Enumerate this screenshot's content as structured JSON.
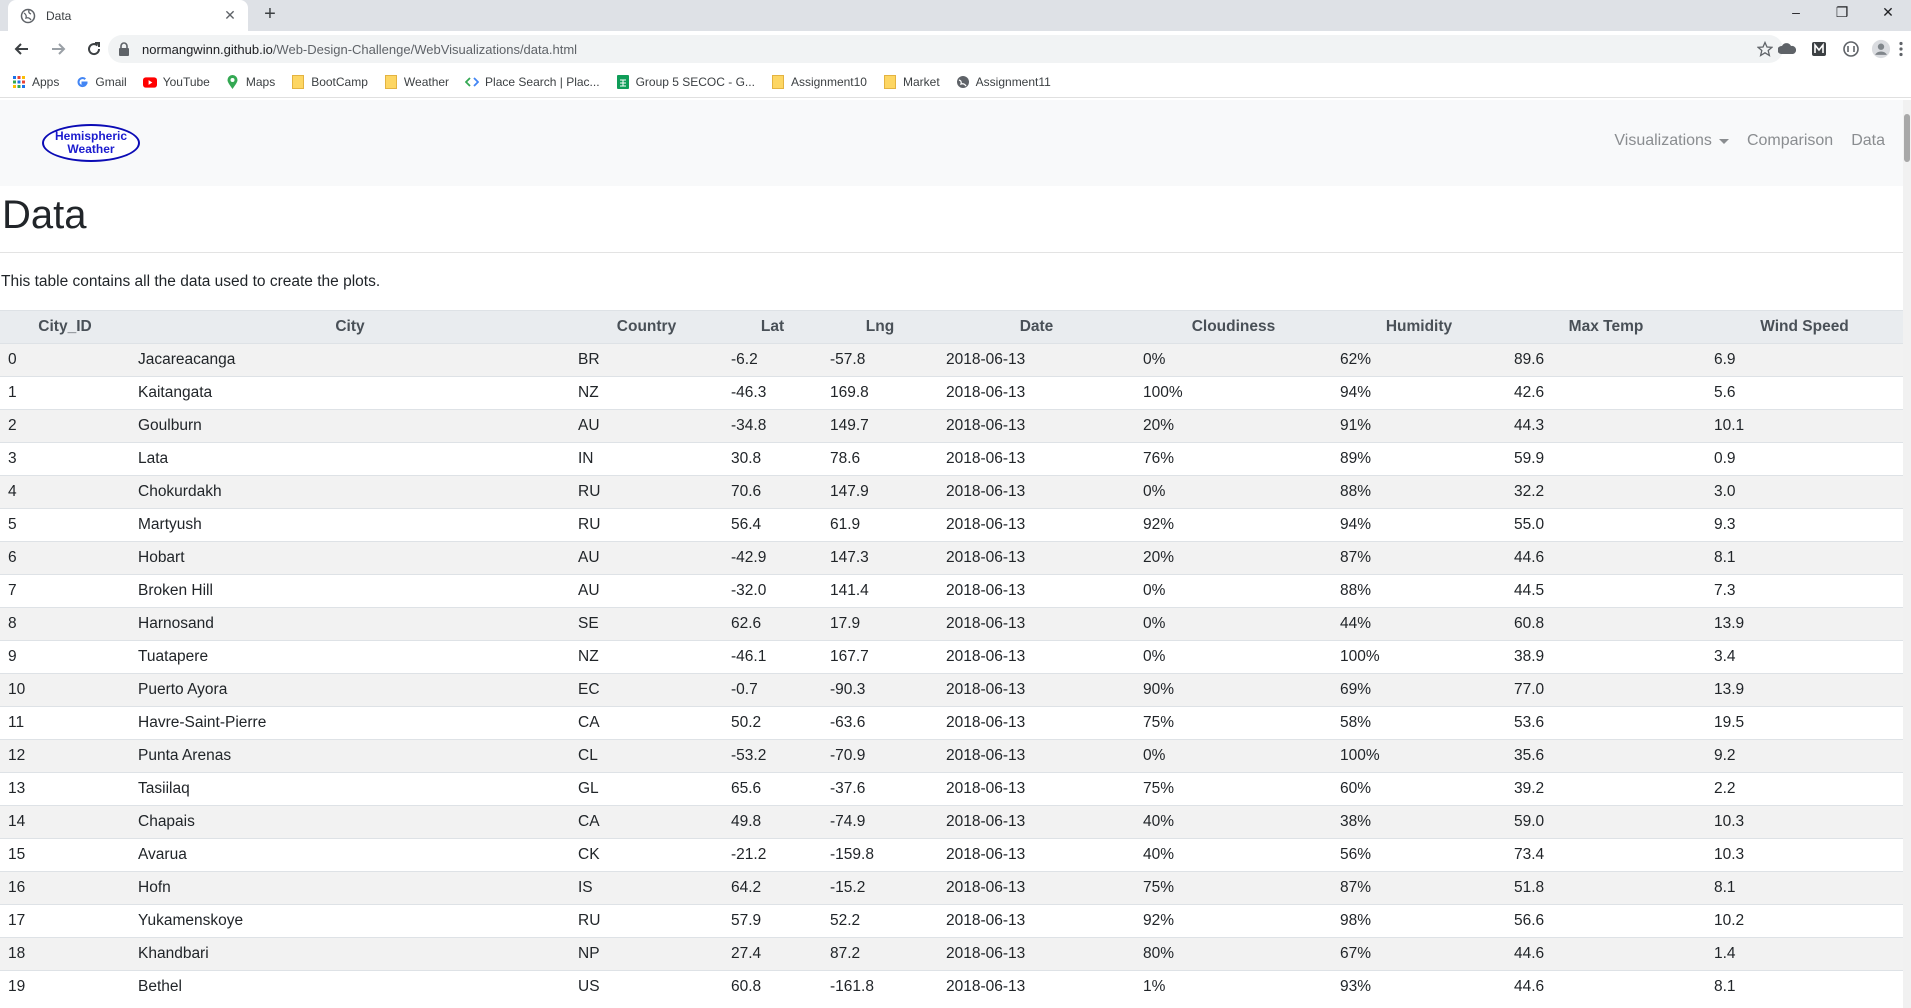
{
  "browser": {
    "tab_title": "Data",
    "url_host": "normangwinn.github.io",
    "url_path": "/Web-Design-Challenge/WebVisualizations/data.html",
    "new_tab_symbol": "+",
    "close_symbol": "✕",
    "window_controls": {
      "minimize": "–",
      "restore": "❐",
      "close": "✕"
    },
    "bookmarks": [
      {
        "label": "Apps",
        "icon": "apps-grid-icon"
      },
      {
        "label": "Gmail",
        "icon": "google-icon"
      },
      {
        "label": "YouTube",
        "icon": "youtube-icon"
      },
      {
        "label": "Maps",
        "icon": "maps-pin-icon"
      },
      {
        "label": "BootCamp",
        "icon": "folder-icon"
      },
      {
        "label": "Weather",
        "icon": "folder-icon"
      },
      {
        "label": "Place Search | Plac...",
        "icon": "code-icon"
      },
      {
        "label": "Group 5 SECOC - G...",
        "icon": "sheets-icon"
      },
      {
        "label": "Assignment10",
        "icon": "folder-icon"
      },
      {
        "label": "Market",
        "icon": "folder-icon"
      },
      {
        "label": "Assignment11",
        "icon": "globe-icon"
      }
    ]
  },
  "site": {
    "logo_line1": "Hemispheric",
    "logo_line2": "Weather",
    "nav": {
      "visualizations": "Visualizations",
      "comparison": "Comparison",
      "data": "Data"
    },
    "title": "Data",
    "description": "This table contains all the data used to create the plots."
  },
  "table": {
    "headers": [
      "City_ID",
      "City",
      "Country",
      "Lat",
      "Lng",
      "Date",
      "Cloudiness",
      "Humidity",
      "Max Temp",
      "Wind Speed"
    ],
    "rows": [
      [
        "0",
        "Jacareacanga",
        "BR",
        "-6.2",
        "-57.8",
        "2018-06-13",
        "0%",
        "62%",
        "89.6",
        "6.9"
      ],
      [
        "1",
        "Kaitangata",
        "NZ",
        "-46.3",
        "169.8",
        "2018-06-13",
        "100%",
        "94%",
        "42.6",
        "5.6"
      ],
      [
        "2",
        "Goulburn",
        "AU",
        "-34.8",
        "149.7",
        "2018-06-13",
        "20%",
        "91%",
        "44.3",
        "10.1"
      ],
      [
        "3",
        "Lata",
        "IN",
        "30.8",
        "78.6",
        "2018-06-13",
        "76%",
        "89%",
        "59.9",
        "0.9"
      ],
      [
        "4",
        "Chokurdakh",
        "RU",
        "70.6",
        "147.9",
        "2018-06-13",
        "0%",
        "88%",
        "32.2",
        "3.0"
      ],
      [
        "5",
        "Martyush",
        "RU",
        "56.4",
        "61.9",
        "2018-06-13",
        "92%",
        "94%",
        "55.0",
        "9.3"
      ],
      [
        "6",
        "Hobart",
        "AU",
        "-42.9",
        "147.3",
        "2018-06-13",
        "20%",
        "87%",
        "44.6",
        "8.1"
      ],
      [
        "7",
        "Broken Hill",
        "AU",
        "-32.0",
        "141.4",
        "2018-06-13",
        "0%",
        "88%",
        "44.5",
        "7.3"
      ],
      [
        "8",
        "Harnosand",
        "SE",
        "62.6",
        "17.9",
        "2018-06-13",
        "0%",
        "44%",
        "60.8",
        "13.9"
      ],
      [
        "9",
        "Tuatapere",
        "NZ",
        "-46.1",
        "167.7",
        "2018-06-13",
        "0%",
        "100%",
        "38.9",
        "3.4"
      ],
      [
        "10",
        "Puerto Ayora",
        "EC",
        "-0.7",
        "-90.3",
        "2018-06-13",
        "90%",
        "69%",
        "77.0",
        "13.9"
      ],
      [
        "11",
        "Havre-Saint-Pierre",
        "CA",
        "50.2",
        "-63.6",
        "2018-06-13",
        "75%",
        "58%",
        "53.6",
        "19.5"
      ],
      [
        "12",
        "Punta Arenas",
        "CL",
        "-53.2",
        "-70.9",
        "2018-06-13",
        "0%",
        "100%",
        "35.6",
        "9.2"
      ],
      [
        "13",
        "Tasiilaq",
        "GL",
        "65.6",
        "-37.6",
        "2018-06-13",
        "75%",
        "60%",
        "39.2",
        "2.2"
      ],
      [
        "14",
        "Chapais",
        "CA",
        "49.8",
        "-74.9",
        "2018-06-13",
        "40%",
        "38%",
        "59.0",
        "10.3"
      ],
      [
        "15",
        "Avarua",
        "CK",
        "-21.2",
        "-159.8",
        "2018-06-13",
        "40%",
        "56%",
        "73.4",
        "10.3"
      ],
      [
        "16",
        "Hofn",
        "IS",
        "64.2",
        "-15.2",
        "2018-06-13",
        "75%",
        "87%",
        "51.8",
        "8.1"
      ],
      [
        "17",
        "Yukamenskoye",
        "RU",
        "57.9",
        "52.2",
        "2018-06-13",
        "92%",
        "98%",
        "56.6",
        "10.2"
      ],
      [
        "18",
        "Khandbari",
        "NP",
        "27.4",
        "87.2",
        "2018-06-13",
        "80%",
        "67%",
        "44.6",
        "1.4"
      ],
      [
        "19",
        "Bethel",
        "US",
        "60.8",
        "-161.8",
        "2018-06-13",
        "1%",
        "93%",
        "44.6",
        "8.1"
      ]
    ]
  }
}
